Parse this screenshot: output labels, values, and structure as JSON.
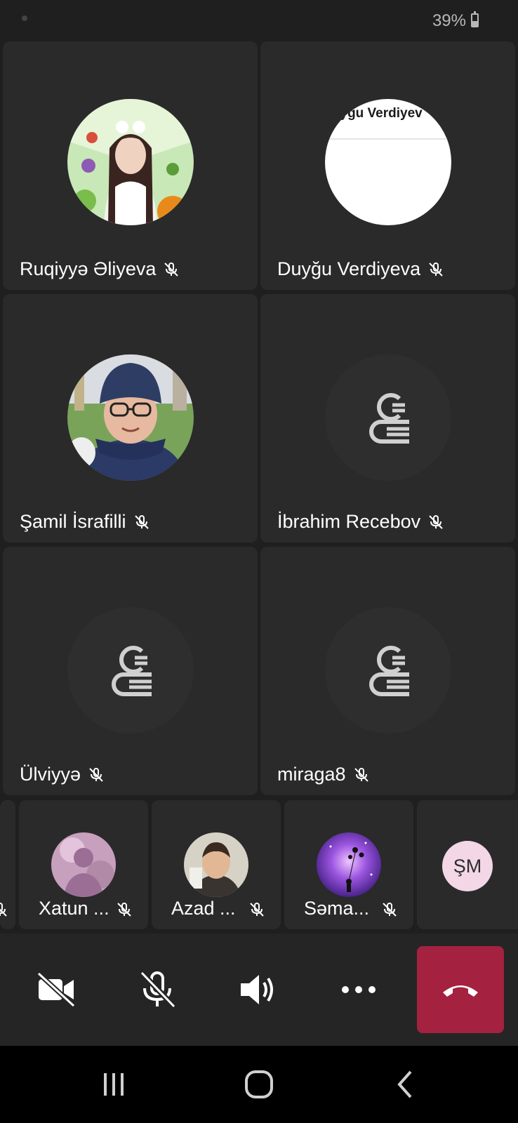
{
  "status_bar": {
    "battery": "39%"
  },
  "participants": [
    {
      "name": "Ruqiyyə Əliyeva",
      "avatar": "photo-girl"
    },
    {
      "name": "Duyğu Verdiyeva",
      "avatar": "image",
      "avatar_caption": "yğu Verdiyev"
    },
    {
      "name": "Şamil İsrafilli",
      "avatar": "photo-boy"
    },
    {
      "name": "İbrahim Recebov",
      "avatar": "default-person-icon"
    },
    {
      "name": "Ülviyyə",
      "avatar": "default-person-icon"
    },
    {
      "name": "miraga8",
      "avatar": "default-person-icon"
    }
  ],
  "strip": [
    {
      "name": "Xatun ...",
      "avatar": "pink-avatar"
    },
    {
      "name": "Azad ...",
      "avatar": "photo-boy-2"
    },
    {
      "name": "Səma...",
      "avatar": "galaxy-avatar"
    },
    {
      "initials": "ŞM"
    }
  ],
  "controls": {
    "camera": "camera-off-icon",
    "mic": "mic-off-icon",
    "speaker": "speaker-icon",
    "more": "more-icon",
    "hangup": "hang-up-icon",
    "hangup_color": "#a4213f"
  },
  "nav": [
    "recent-apps-icon",
    "home-icon",
    "back-icon"
  ]
}
